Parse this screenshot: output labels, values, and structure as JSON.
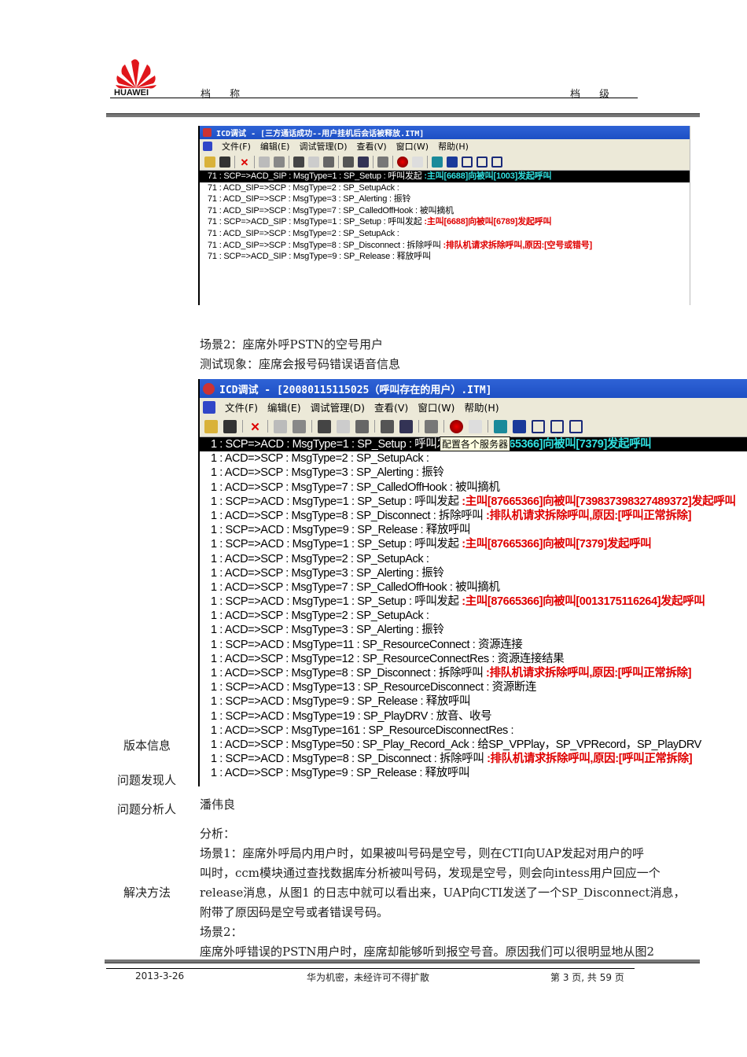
{
  "header": {
    "brand": "HUAWEI",
    "doc_name_label": "档 称",
    "doc_level_label": "档 级"
  },
  "window1": {
    "title": "ICD调试 - [三方通话成功--用户挂机后会话被释放.ITM]",
    "menu": [
      "文件(F)",
      "编辑(E)",
      "调试管理(D)",
      "查看(V)",
      "窗口(W)",
      "帮助(H)"
    ],
    "rows": [
      {
        "a": "71 : SCP=>ACD_SIP : MsgType=1 : SP_Setup : 呼叫发起 ",
        "b": ":主叫[6688]向被叫[1003]发起呼叫"
      },
      {
        "a": "71 : ACD_SIP=>SCP : MsgType=2 : SP_SetupAck :",
        "b": ""
      },
      {
        "a": "71 : ACD_SIP=>SCP : MsgType=3 : SP_Alerting : 振铃",
        "b": ""
      },
      {
        "a": "71 : ACD_SIP=>SCP : MsgType=7 : SP_CalledOffHook : 被叫摘机",
        "b": ""
      },
      {
        "a": "71 : SCP=>ACD_SIP : MsgType=1 : SP_Setup : 呼叫发起 ",
        "b": ":主叫[6688]向被叫[6789]发起呼叫"
      },
      {
        "a": "71 : ACD_SIP=>SCP : MsgType=2 : SP_SetupAck :",
        "b": ""
      },
      {
        "a": "71 : ACD_SIP=>SCP : MsgType=8 : SP_Disconnect : 拆除呼叫 ",
        "b": ":排队机请求拆除呼叫,原因:[空号或错号]"
      },
      {
        "a": "71 : SCP=>ACD_SIP : MsgType=9 : SP_Release : 释放呼叫",
        "b": ""
      }
    ]
  },
  "scene2": {
    "title": "场景2：座席外呼PSTN的空号用户",
    "phenomenon": "测试现象：座席会报号码错误语音信息"
  },
  "window2": {
    "title": "ICD调试 - [20080115115025（呼叫存在的用户）.ITM]",
    "menu": [
      "文件(F)",
      "编辑(E)",
      "调试管理(D)",
      "查看(V)",
      "窗口(W)",
      "帮助(H)"
    ],
    "tooltip": "配置各个服务器",
    "rows": [
      {
        "a": "1 : SCP=>ACD : MsgType=1 : SP_Setup : 呼叫发起 ",
        "b": ":主叫[87665366]向被叫[7379]发起呼叫"
      },
      {
        "a": "1 : ACD=>SCP : MsgType=2 : SP_SetupAck :",
        "b": ""
      },
      {
        "a": "1 : ACD=>SCP : MsgType=3 : SP_Alerting : 振铃",
        "b": ""
      },
      {
        "a": "1 : ACD=>SCP : MsgType=7 : SP_CalledOffHook : 被叫摘机",
        "b": ""
      },
      {
        "a": "1 : SCP=>ACD : MsgType=1 : SP_Setup : 呼叫发起 ",
        "b": ":主叫[87665366]向被叫[739837398327489372]发起呼叫"
      },
      {
        "a": "1 : ACD=>SCP : MsgType=8 : SP_Disconnect : 拆除呼叫 ",
        "b": ":排队机请求拆除呼叫,原因:[呼叫正常拆除]"
      },
      {
        "a": "1 : SCP=>ACD : MsgType=9 : SP_Release : 释放呼叫",
        "b": ""
      },
      {
        "a": "1 : SCP=>ACD : MsgType=1 : SP_Setup : 呼叫发起 ",
        "b": ":主叫[87665366]向被叫[7379]发起呼叫"
      },
      {
        "a": "1 : ACD=>SCP : MsgType=2 : SP_SetupAck :",
        "b": ""
      },
      {
        "a": "1 : ACD=>SCP : MsgType=3 : SP_Alerting : 振铃",
        "b": ""
      },
      {
        "a": "1 : ACD=>SCP : MsgType=7 : SP_CalledOffHook : 被叫摘机",
        "b": ""
      },
      {
        "a": "1 : SCP=>ACD : MsgType=1 : SP_Setup : 呼叫发起 ",
        "b": ":主叫[87665366]向被叫[0013175116264]发起呼叫"
      },
      {
        "a": "1 : ACD=>SCP : MsgType=2 : SP_SetupAck :",
        "b": ""
      },
      {
        "a": "1 : ACD=>SCP : MsgType=3 : SP_Alerting : 振铃",
        "b": ""
      },
      {
        "a": "1 : SCP=>ACD : MsgType=11 : SP_ResourceConnect : 资源连接",
        "b": ""
      },
      {
        "a": "1 : ACD=>SCP : MsgType=12 : SP_ResourceConnectRes : 资源连接结果",
        "b": ""
      },
      {
        "a": "1 : ACD=>SCP : MsgType=8 : SP_Disconnect : 拆除呼叫 ",
        "b": ":排队机请求拆除呼叫,原因:[呼叫正常拆除]"
      },
      {
        "a": "1 : SCP=>ACD : MsgType=13 : SP_ResourceDisconnect : 资源断连",
        "b": ""
      },
      {
        "a": "1 : SCP=>ACD : MsgType=9 : SP_Release : 释放呼叫",
        "b": ""
      },
      {
        "a": "1 : SCP=>ACD : MsgType=19 : SP_PlayDRV : 放音、收号",
        "b": ""
      },
      {
        "a": "1 : ACD=>SCP : MsgType=161 : SP_ResourceDisconnectRes :",
        "b": ""
      },
      {
        "a": "1 : ACD=>SCP : MsgType=50 : SP_Play_Record_Ack : 给SP_VPPlay，SP_VPRecord，SP_PlayDRV",
        "b": ""
      },
      {
        "a": "1 : SCP=>ACD : MsgType=8 : SP_Disconnect : 拆除呼叫 ",
        "b": ":排队机请求拆除呼叫,原因:[呼叫正常拆除]"
      },
      {
        "a": "1 : ACD=>SCP : MsgType=9 : SP_Release : 释放呼叫",
        "b": ""
      }
    ]
  },
  "labels": {
    "version": "版本信息",
    "finder": "问题发现人",
    "analyst": "问题分析人",
    "solution": "解决方法"
  },
  "analyst_name": "潘伟良",
  "analysis": [
    "分析：",
    "场景1：座席外呼局内用户时，如果被叫号码是空号，则在CTI向UAP发起对用户的呼",
    "叫时，ccm模块通过查找数据库分析被叫号码，发现是空号，则会向intess用户回应一个",
    "release消息，从图1  的日志中就可以看出来，UAP向CTI发送了一个SP_Disconnect消息，",
    "附带了原因码是空号或者错误号码。",
    "场景2：",
    "座席外呼错误的PSTN用户时，座席却能够听到报空号音。原因我们可以很明显地从图2"
  ],
  "footer": {
    "date": "2013-3-26",
    "confidential": "华为机密，未经许可不得扩散",
    "page": "第 3 页, 共 59 页"
  }
}
